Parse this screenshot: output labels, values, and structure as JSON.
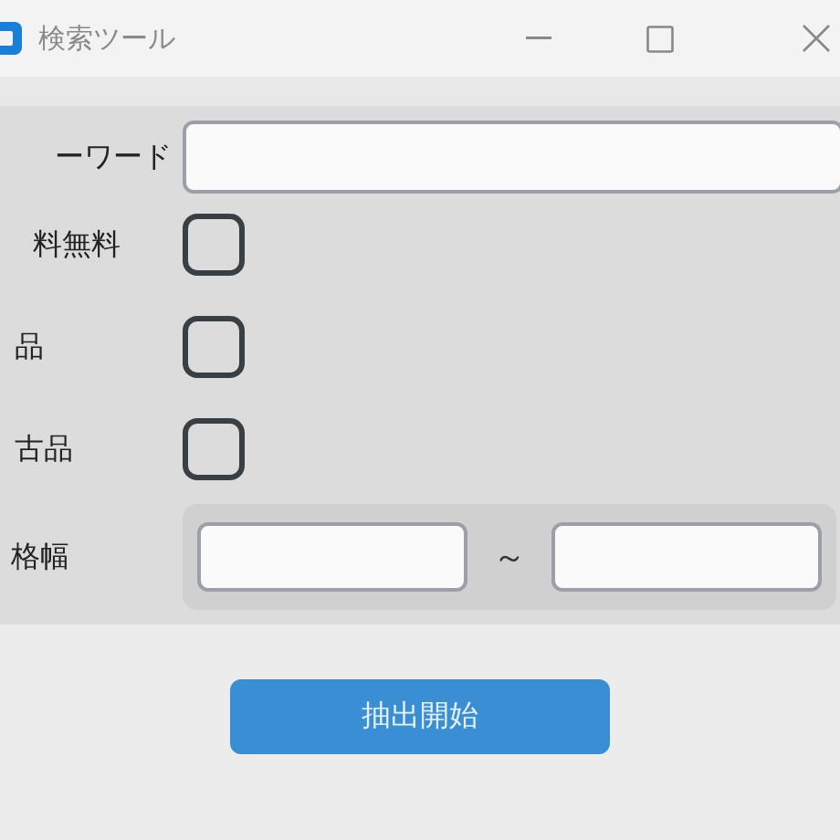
{
  "window": {
    "title": "検索ツール"
  },
  "keyword": {
    "label": "ーワード"
  },
  "checks": [
    {
      "label": "料無料",
      "checked": false
    },
    {
      "label": "品",
      "checked": false
    },
    {
      "label": "古品",
      "checked": false
    }
  ],
  "price": {
    "label": "格幅",
    "separator": "～"
  },
  "button": "抽出開始"
}
